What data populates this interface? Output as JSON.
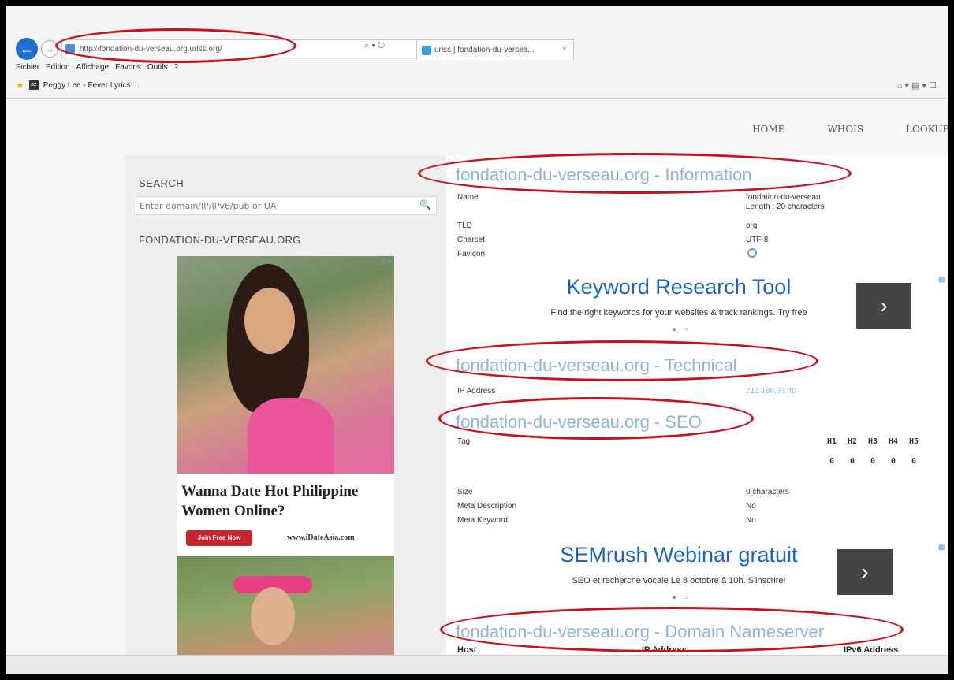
{
  "browser": {
    "address": "http://fondation-du-verseau.org.urlss.org/",
    "address_tools": "⌕ ▾ ↻",
    "tab_title": "urlss | fondation-du-versea...",
    "tab_close": "×",
    "menu": [
      "Fichier",
      "Edition",
      "Affichage",
      "Favoris",
      "Outils",
      "?"
    ],
    "favorite": "Peggy Lee - Fever Lyrics ...",
    "right_tools": "⌂ ▾ ▤ ▾ ☐"
  },
  "nav": {
    "home": "HOME",
    "whois": "WHOIS",
    "lookup": "LOOKUP I"
  },
  "sidebar": {
    "search_heading": "SEARCH",
    "search_placeholder": "Enter domain/IP/IPv6/pub or UA",
    "domain_heading": "FONDATION-DU-VERSEAU.ORG"
  },
  "ad": {
    "headline": "Wanna Date Hot Philippine Women Online?",
    "join_label": "Join Free Now",
    "brand": "www.iDateAsia.com",
    "adchoice": "▷✕"
  },
  "information": {
    "title": "fondation-du-verseau.org - Information",
    "rows": [
      {
        "label": "Name",
        "value": "fondation-du-verseau",
        "value2": "Length : 20 characters"
      },
      {
        "label": "TLD",
        "value": "org"
      },
      {
        "label": "Charset",
        "value": "UTF-8"
      },
      {
        "label": "Favicon"
      }
    ]
  },
  "banner1": {
    "title": "Keyword Research Tool",
    "subtitle": "Find the right keywords for your websites & track rankings. Try free",
    "dots": "● ○",
    "arrow": "›"
  },
  "technical": {
    "title": "fondation-du-verseau.org - Technical",
    "ip_label": "IP Address",
    "ip_value": "213.186.33.40"
  },
  "seo": {
    "title": "fondation-du-verseau.org - SEO",
    "tag_label": "Tag",
    "headings": [
      "H1",
      "H2",
      "H3",
      "H4",
      "H5"
    ],
    "heading_counts": [
      "0",
      "0",
      "0",
      "0",
      "0"
    ],
    "rows": [
      {
        "label": "Size",
        "value": "0 characters"
      },
      {
        "label": "Meta Description",
        "value": "No"
      },
      {
        "label": "Meta Keyword",
        "value": "No"
      }
    ]
  },
  "banner2": {
    "title": "SEMrush Webinar gratuit",
    "subtitle": "SEO et recherche vocale Le 8 octobre à 10h. S'inscrire!",
    "dots": "● ○",
    "arrow": "›"
  },
  "nameserver": {
    "title": "fondation-du-verseau.org - Domain Nameserver",
    "headers": [
      "Host",
      "IP Address",
      "IPv6 Address"
    ]
  },
  "colors": {
    "accent_blue": "#8eb4d8",
    "ad_title_blue": "#1a63c3",
    "annotation_red": "#c8101e"
  }
}
